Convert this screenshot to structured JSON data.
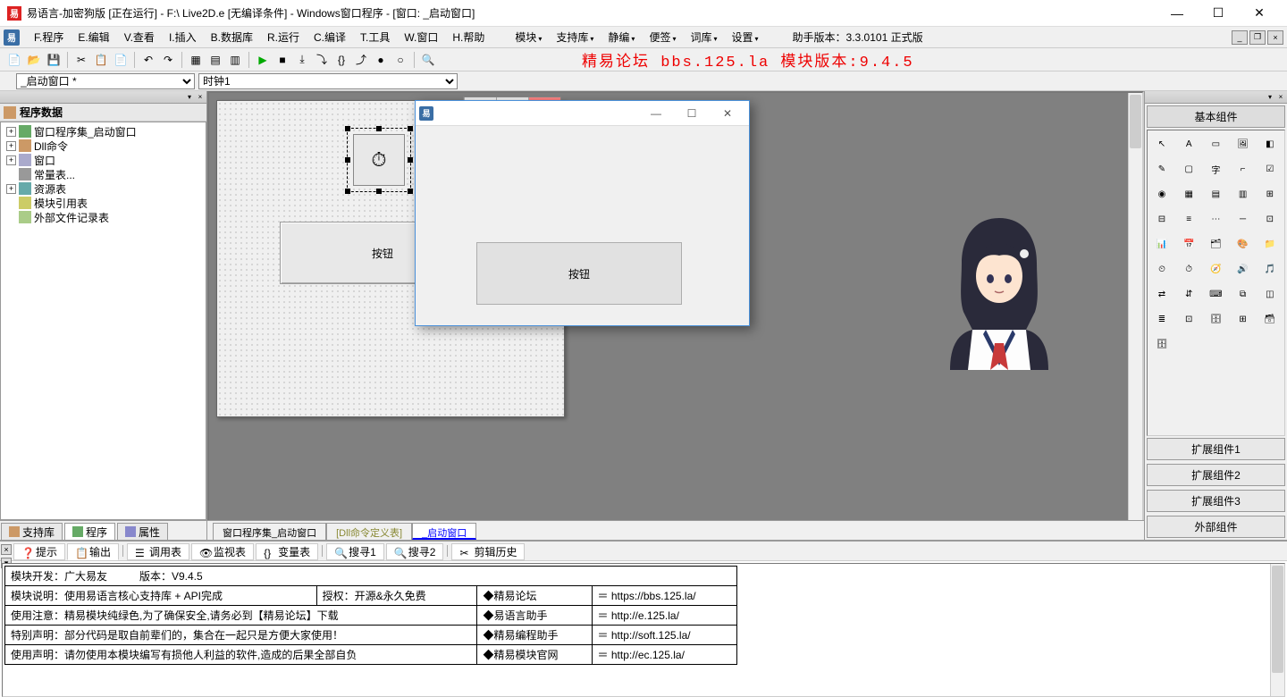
{
  "title": "易语言-加密狗版 [正在运行] - F:\\                                                                        Live2D.e [无编译条件] - Windows窗口程序 - [窗口: _启动窗口]",
  "menu": [
    "F.程序",
    "E.编辑",
    "V.查看",
    "I.插入",
    "B.数据库",
    "R.运行",
    "C.编译",
    "T.工具",
    "W.窗口",
    "H.帮助"
  ],
  "menu_dropdowns": [
    "模块",
    "支持库",
    "静编",
    "便签",
    "词库",
    "设置"
  ],
  "version_label": "助手版本：3.3.0101 正式版",
  "banner": "精易论坛 bbs.125.la 模块版本:9.4.5",
  "selectors": {
    "left": "_启动窗口 *",
    "right": "时钟1"
  },
  "tree": {
    "title": "程序数据",
    "items": [
      {
        "exp": "+",
        "icon": "#6a6",
        "label": "窗口程序集_启动窗口"
      },
      {
        "exp": "+",
        "icon": "#c96",
        "label": "Dll命令"
      },
      {
        "exp": "+",
        "icon": "#aac",
        "label": "窗口"
      },
      {
        "exp": "",
        "icon": "#999",
        "label": "常量表..."
      },
      {
        "exp": "+",
        "icon": "#6aa",
        "label": "资源表"
      },
      {
        "exp": "",
        "icon": "#cc6",
        "label": "模块引用表"
      },
      {
        "exp": "",
        "icon": "#ac8",
        "label": "外部文件记录表"
      }
    ]
  },
  "left_tabs": [
    {
      "icon": "#c96",
      "label": "支持库"
    },
    {
      "icon": "#6a6",
      "label": "程序",
      "active": true
    },
    {
      "icon": "#88c",
      "label": "属性"
    }
  ],
  "designer": {
    "button_label": "按钮",
    "timer_icon": "⏱"
  },
  "runtime": {
    "button_label": "按钮"
  },
  "doc_tabs": [
    {
      "label": "窗口程序集_启动窗口",
      "cls": ""
    },
    {
      "label": "[Dll命令定义表]",
      "cls": "alt"
    },
    {
      "label": "_启动窗口",
      "cls": "active"
    }
  ],
  "bottom_tabs": [
    "提示",
    "输出",
    "调用表",
    "监视表",
    "变量表",
    "搜寻1",
    "搜寻2",
    "剪辑历史"
  ],
  "bottom_active": 1,
  "output_rows": [
    [
      "模块开发：广大易友　　　版本：V9.4.5",
      "",
      "",
      ""
    ],
    [
      "模块说明：使用易语言核心支持库 + API完成",
      "授权：开源&永久免费",
      "◆精易论坛",
      "＝ https://bbs.125.la/"
    ],
    [
      "使用注意：精易模块纯绿色,为了确保安全,请务必到【精易论坛】下载",
      "",
      "◆易语言助手",
      "＝ http://e.125.la/"
    ],
    [
      "特别声明：部分代码是取自前辈们的，集合在一起只是方便大家使用！",
      "",
      "◆精易编程助手",
      "＝ http://soft.125.la/"
    ],
    [
      "使用声明：请勿使用本模块编写有损他人利益的软件,造成的后果全部自负",
      "",
      "◆精易模块官网",
      "＝ http://ec.125.la/"
    ]
  ],
  "right": {
    "header": "基本组件",
    "groups": [
      "扩展组件1",
      "扩展组件2",
      "扩展组件3",
      "外部组件"
    ]
  },
  "palette_count": 41
}
